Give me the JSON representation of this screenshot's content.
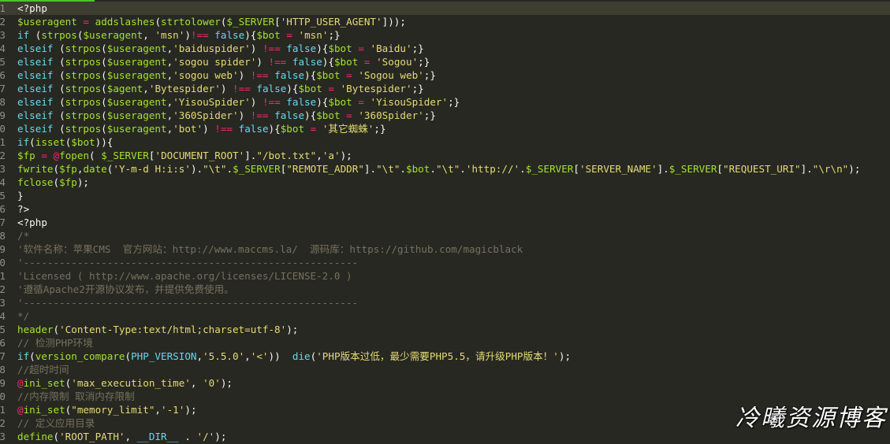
{
  "editor": {
    "lines": [
      {
        "n": "1",
        "text": "<?php",
        "cls": "w",
        "hl": true
      },
      {
        "n": "2",
        "text": "$useragent = addslashes(strtolower($_SERVER['HTTP_USER_AGENT']));",
        "cls": "w"
      },
      {
        "n": "3",
        "text": "if (strpos($useragent, 'msn')!== false){$bot = 'msn';}",
        "cls": "w"
      },
      {
        "n": "4",
        "text": "elseif (strpos($useragent,'baiduspider') !== false){$bot = 'Baidu';}",
        "cls": "w"
      },
      {
        "n": "5",
        "text": "elseif (strpos($useragent,'sogou spider') !== false){$bot = 'Sogou';}",
        "cls": "w"
      },
      {
        "n": "6",
        "text": "elseif (strpos($useragent,'sogou web') !== false){$bot = 'Sogou web';}",
        "cls": "w"
      },
      {
        "n": "7",
        "text": "elseif (strpos($agent,'Bytespider') !== false){$bot = 'Bytespider';}",
        "cls": "w"
      },
      {
        "n": "8",
        "text": "elseif (strpos($useragent,'YisouSpider') !== false){$bot = 'YisouSpider';}",
        "cls": "w"
      },
      {
        "n": "9",
        "text": "elseif (strpos($useragent,'360Spider') !== false){$bot = '360Spider';}",
        "cls": "w"
      },
      {
        "n": "0",
        "text": "elseif (strpos($useragent,'bot') !== false){$bot = '其它蜘蛛';}",
        "cls": "w"
      },
      {
        "n": "1",
        "text": "if(isset($bot)){",
        "cls": "w"
      },
      {
        "n": "2",
        "text": "$fp = @fopen( $_SERVER['DOCUMENT_ROOT'].\"/bot.txt\",'a');",
        "cls": "w"
      },
      {
        "n": "3",
        "text": "fwrite($fp,date('Y-m-d H:i:s').\"\\t\".$_SERVER[\"REMOTE_ADDR\"].\"\\t\".$bot.\"\\t\".'http://'.$_SERVER['SERVER_NAME'].$_SERVER[\"REQUEST_URI\"].\"\\r\\n\");",
        "cls": "w"
      },
      {
        "n": "4",
        "text": "fclose($fp);",
        "cls": "w"
      },
      {
        "n": "5",
        "text": "}",
        "cls": "w"
      },
      {
        "n": "6",
        "text": "?>",
        "cls": "w"
      },
      {
        "n": "7",
        "text": "<?php",
        "cls": "w"
      },
      {
        "n": "8",
        "text": "/*",
        "cls": "c"
      },
      {
        "n": "9",
        "text": "'软件名称：苹果CMS  官方网站：http://www.maccms.la/  源码库：https://github.com/magicblack",
        "cls": "c"
      },
      {
        "n": "0",
        "text": "'--------------------------------------------------------",
        "cls": "c"
      },
      {
        "n": "1",
        "text": "'Licensed ( http://www.apache.org/licenses/LICENSE-2.0 )",
        "cls": "c"
      },
      {
        "n": "2",
        "text": "'遵循Apache2开源协议发布，并提供免费使用。",
        "cls": "c"
      },
      {
        "n": "3",
        "text": "'--------------------------------------------------------",
        "cls": "c"
      },
      {
        "n": "4",
        "text": "*/",
        "cls": "c"
      },
      {
        "n": "5",
        "text": "header('Content-Type:text/html;charset=utf-8');",
        "cls": "w"
      },
      {
        "n": "6",
        "text": "// 检测PHP环境",
        "cls": "c"
      },
      {
        "n": "7",
        "text": "if(version_compare(PHP_VERSION,'5.5.0','<'))  die('PHP版本过低，最少需要PHP5.5，请升级PHP版本！');",
        "cls": "w"
      },
      {
        "n": "8",
        "text": "//超时时间",
        "cls": "c"
      },
      {
        "n": "9",
        "text": "@ini_set('max_execution_time', '0');",
        "cls": "w"
      },
      {
        "n": "0",
        "text": "//内存限制 取消内存限制",
        "cls": "c"
      },
      {
        "n": "1",
        "text": "@ini_set(\"memory_limit\",'-1');",
        "cls": "w"
      },
      {
        "n": "2",
        "text": "// 定义应用目录",
        "cls": "c"
      },
      {
        "n": "3",
        "text": "define('ROOT_PATH', __DIR__ . '/');",
        "cls": "w"
      }
    ]
  },
  "watermark": "冷曦资源博客",
  "colors": {
    "background": "#272822",
    "comment": "#75715e",
    "string": "#e6db74",
    "keyword": "#66d9ef",
    "function": "#a6e22e",
    "current_line": "#3e3d32"
  }
}
